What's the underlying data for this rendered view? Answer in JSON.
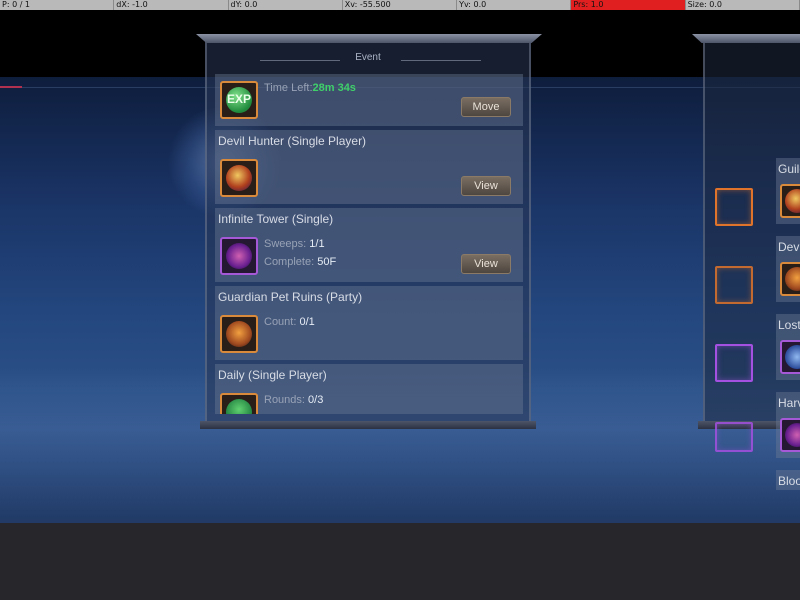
{
  "debug_bar": {
    "cells": [
      "P: 0 / 1",
      "dX: -1.0",
      "dY: 0.0",
      "Xv: -55.500",
      "Yv: 0.0",
      "Prs: 1.0",
      "Size: 0.0"
    ]
  },
  "colors": {
    "accent_green": "#3fd06a",
    "frame_orange": "#d98a3a",
    "frame_purple": "#a659d6",
    "debug_alert": "#e02020"
  },
  "event_panel": {
    "title": "Event",
    "cards": [
      {
        "name": "",
        "icon": "exp-orb-icon",
        "icon_text": "EXP",
        "time_left_label": "Time Left:",
        "time_left_value": "28m 34s",
        "button": "Move"
      },
      {
        "name": "Devil Hunter (Single Player)",
        "icon": "devil-dragon-icon",
        "button": "View"
      },
      {
        "name": "Infinite Tower (Single)",
        "icon": "tower-gem-icon",
        "sweeps_label": "Sweeps:",
        "sweeps_value": "1/1",
        "complete_label": "Complete:",
        "complete_value": "50F",
        "button": "View"
      },
      {
        "name": "Guardian Pet Ruins (Party)",
        "icon": "guardian-egg-icon",
        "count_label": "Count:",
        "count_value": "0/1"
      },
      {
        "name": "Daily (Single Player)",
        "icon": "daily-orb-icon",
        "rounds_label": "Rounds:",
        "rounds_value": "0/3"
      }
    ]
  },
  "right_panel": {
    "cards": [
      {
        "name": "Guild",
        "icon": "guild-icon"
      },
      {
        "name": "Devi",
        "icon": "devil-icon"
      },
      {
        "name": "Lost",
        "icon": "lost-icon"
      },
      {
        "name": "Harv",
        "icon": "harvest-icon"
      },
      {
        "name": "Bloo",
        "icon": "blood-icon"
      }
    ]
  }
}
